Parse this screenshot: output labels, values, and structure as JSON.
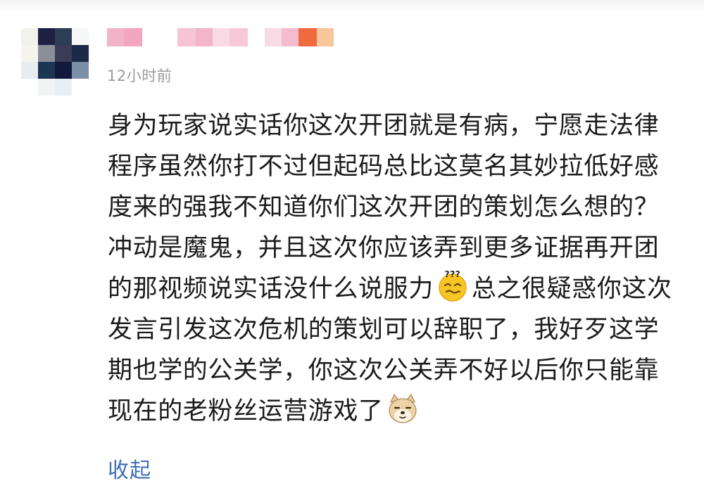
{
  "comment": {
    "author": {
      "avatar_icon": "avatar-mosaic",
      "name_censored": true
    },
    "timestamp": "12小时前",
    "segments": [
      {
        "type": "text",
        "value": "身为玩家说实话你这次开团就是有病，宁愿走法律程序虽然你打不过但起码总比这莫名其妙拉低好感度来的强我不知道你们这次开团的策划怎么想的？冲动是魔鬼，并且这次你应该弄到更多证据再开团的那视频说实话没什么说服力"
      },
      {
        "type": "emoji",
        "icon": "confused-face-emoji"
      },
      {
        "type": "text",
        "value": "总之很疑惑你这次发言引发这次危机的策划可以辞职了，我好歹这学期也学的公关学，你这次公关弄不好以后你只能靠现在的老粉丝运营游戏了"
      },
      {
        "type": "emoji",
        "icon": "shiba-dog-emoji"
      }
    ],
    "collapse_label": "收起"
  },
  "colors": {
    "text": "#1c1c1e",
    "timestamp": "#9a9aa0",
    "link": "#3d6fb6"
  }
}
